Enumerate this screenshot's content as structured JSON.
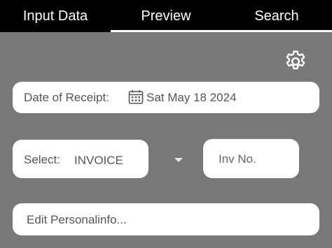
{
  "tabs": [
    {
      "label": "Input Data"
    },
    {
      "label": "Preview"
    },
    {
      "label": "Search"
    }
  ],
  "active_tab": "Preview",
  "settings_icon": "gear-icon",
  "date": {
    "label": "Date of Receipt:",
    "icon": "calendar-icon",
    "value": "Sat May 18 2024"
  },
  "select": {
    "label": "Select:",
    "value": "INVOICE"
  },
  "inv_no": {
    "placeholder": "Inv No."
  },
  "personal_info": {
    "placeholder": "Edit Personalinfo..."
  },
  "colors": {
    "background": "#787878",
    "tabbar": "#000000",
    "field": "#ffffff"
  }
}
